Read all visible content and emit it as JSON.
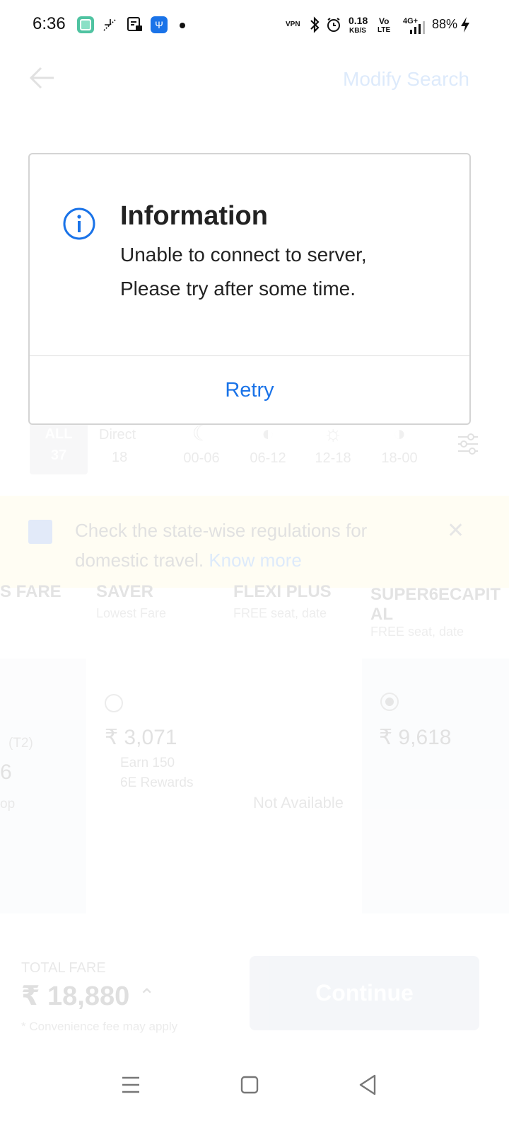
{
  "status_bar": {
    "time": "6:36",
    "net_speed_value": "0.18",
    "net_speed_unit": "KB/S",
    "vpn_label": "VPN",
    "volte_label_top": "Vo",
    "volte_label_bottom": "LTE",
    "signal_label": "4G+",
    "battery": "88%"
  },
  "header": {
    "modify_search": "Modify Search"
  },
  "filters": {
    "all_label": "ALL",
    "all_count": "37",
    "direct_label": "Direct",
    "direct_count": "18",
    "time_slots": [
      "00-06",
      "06-12",
      "12-18",
      "18-00"
    ]
  },
  "notice": {
    "text": "Check the state-wise regulations for domestic travel.",
    "link": "Know more"
  },
  "fares": {
    "col1_header": "S FARE",
    "col1_terminal": "(T2)",
    "col1_digit": "6",
    "col1_partial": "op",
    "saver_header": "SAVER",
    "saver_sub": "Lowest Fare",
    "saver_price": "₹ 3,071",
    "saver_reward_line1": "Earn 150",
    "saver_reward_line2": "6E Rewards",
    "flexi_header": "FLEXI PLUS",
    "flexi_sub": "FREE seat, date",
    "flexi_status": "Not Available",
    "super_header_line1": "SUPER6ECAPIT",
    "super_header_line2": "AL",
    "super_sub": "FREE seat, date",
    "super_price": "₹ 9,618"
  },
  "bottom": {
    "total_label": "TOTAL FARE",
    "total_value": "₹ 18,880",
    "fee_note": "* Convenience fee may apply",
    "continue": "Continue"
  },
  "dialog": {
    "title": "Information",
    "message_line1": "Unable to connect to server,",
    "message_line2": "Please try after some time.",
    "retry": "Retry",
    "accent_color": "#1a73e8"
  }
}
